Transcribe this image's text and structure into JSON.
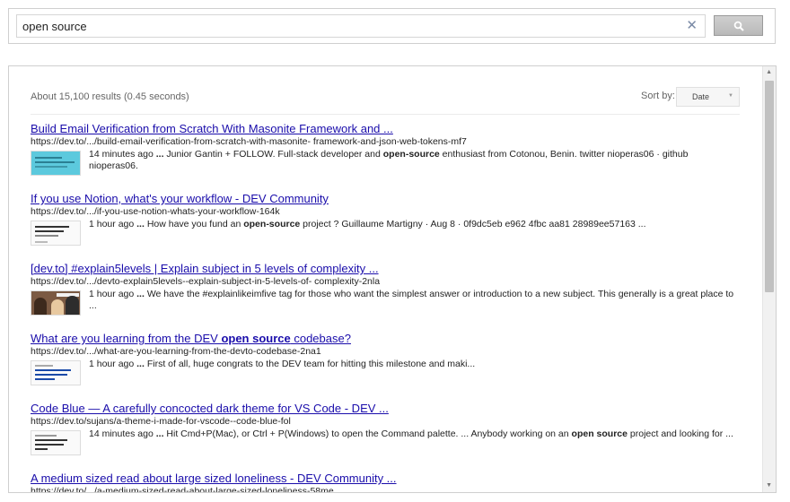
{
  "search": {
    "query": "open source",
    "clear_glyph": "✕",
    "button_icon": "search-icon"
  },
  "results_header": {
    "stats": "About 15,100 results (0.45 seconds)",
    "sort_label": "Sort by:",
    "sort_value": "Date"
  },
  "results": [
    {
      "title": "Build Email Verification from Scratch With Masonite Framework and ...",
      "url": "https://dev.to/.../build-email-verification-from-scratch-with-masonite- framework-and-json-web-tokens-mf7",
      "time": "14 minutes ago",
      "snippet_a": "Junior Gantin + FOLLOW. Full-stack developer and ",
      "snippet_bold": "open-source",
      "snippet_b": " enthusiast from Cotonou, Benin. twitter nioperas06 · github nioperas06."
    },
    {
      "title": "If you use Notion, what's your workflow - DEV Community",
      "url": "https://dev.to/.../if-you-use-notion-whats-your-workflow-164k",
      "time": "1 hour ago",
      "snippet_a": "How have you fund an ",
      "snippet_bold": "open-source",
      "snippet_b": " project ? Guillaume Martigny · Aug 8 · 0f9dc5eb e962 4fbc aa81 28989ee57163 ..."
    },
    {
      "title": "[dev.to] #explain5levels | Explain subject in 5 levels of complexity ...",
      "url": "https://dev.to/.../devto-explain5levels--explain-subject-in-5-levels-of- complexity-2nla",
      "time": "1 hour ago",
      "snippet_a": "We have the #explainlikeimfive tag for those who want the simplest answer or introduction to a new subject. This generally is a great place to ...",
      "snippet_bold": "",
      "snippet_b": ""
    },
    {
      "title_a": "What are you learning from the DEV ",
      "title_bold": "open source",
      "title_b": " codebase?",
      "url": "https://dev.to/.../what-are-you-learning-from-the-devto-codebase-2na1",
      "time": "1 hour ago",
      "snippet_a": "First of all, huge congrats to the DEV team for hitting this milestone and maki...",
      "snippet_bold": "",
      "snippet_b": ""
    },
    {
      "title": "Code Blue — A carefully concocted dark theme for VS Code - DEV ...",
      "url": "https://dev.to/sujans/a-theme-i-made-for-vscode--code-blue-fol",
      "time": "14 minutes ago",
      "snippet_a": "Hit Cmd+P(Mac), or Ctrl + P(Windows) to open the Command palette. ... Anybody working on an ",
      "snippet_bold": "open source",
      "snippet_b": " project and looking for ..."
    },
    {
      "title": "A medium sized read about large sized loneliness - DEV Community ...",
      "url": "https://dev.to/.../a-medium-sized-read-about-large-sized-loneliness-58me"
    }
  ],
  "colors": {
    "link": "#1a0dab",
    "text": "#222222",
    "muted": "#666666",
    "border": "#cfcfcf"
  }
}
